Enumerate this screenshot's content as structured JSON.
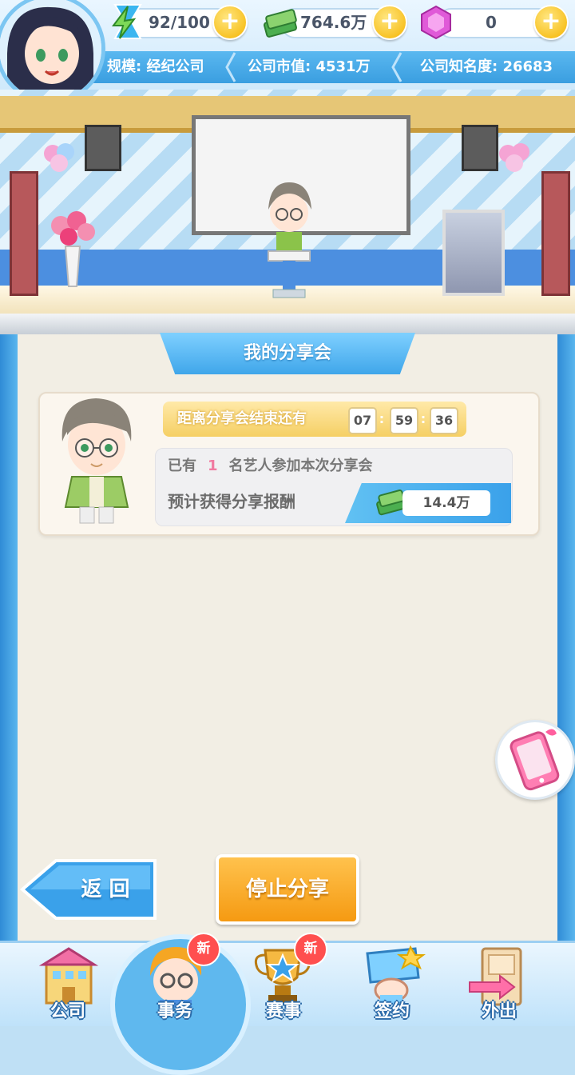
{
  "top": {
    "energy": "92/100",
    "money": "764.6万",
    "gems": "0",
    "plus": "+"
  },
  "stats": {
    "scale": "规模: 经纪公司",
    "market_value": "公司市值: 4531万",
    "fame": "公司知名度: 26683"
  },
  "panel": {
    "title": "我的分享会",
    "timer_label": "距离分享会结束还有",
    "timer": {
      "h": "07",
      "m": "59",
      "s": "36"
    },
    "participants_prefix": "已有",
    "participants_count": "1",
    "participants_suffix": "名艺人参加本次分享会",
    "reward_label": "预计获得分享报酬",
    "reward_value": "14.4万"
  },
  "buttons": {
    "back": "返 回",
    "stop": "停止分享"
  },
  "nav": {
    "items": [
      {
        "label": "公司",
        "badge": ""
      },
      {
        "label": "事务",
        "badge": "新"
      },
      {
        "label": "赛事",
        "badge": "新"
      },
      {
        "label": "签约",
        "badge": ""
      },
      {
        "label": "外出",
        "badge": ""
      }
    ]
  },
  "colors": {
    "accent_blue": "#3aa1ea",
    "orange_button": "#f5a21c",
    "badge_red": "#ff4f4f"
  }
}
